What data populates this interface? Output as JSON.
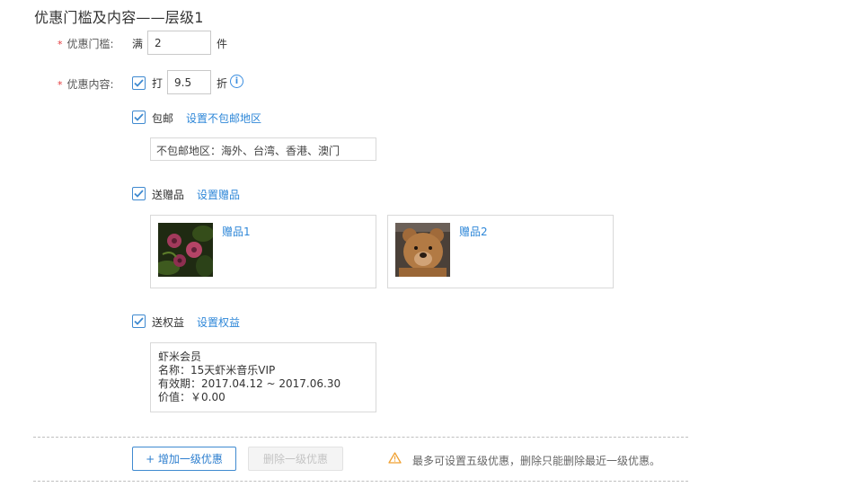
{
  "header": {
    "title": "优惠门槛及内容——层级1"
  },
  "threshold": {
    "label": "优惠门槛:",
    "prefix": "满",
    "value": "2",
    "suffix": "件"
  },
  "content": {
    "label": "优惠内容:",
    "discount": {
      "prefix": "打",
      "value": "9.5",
      "suffix": "折",
      "checked": true
    },
    "shipping": {
      "label": "包邮",
      "link": "设置不包邮地区",
      "checked": true,
      "excluded_regions": "不包邮地区：海外、台湾、香港、澳门"
    },
    "gifts": {
      "label": "送赠品",
      "link": "设置赠品",
      "checked": true,
      "items": [
        {
          "name": "赠品1",
          "image": "flower-photo"
        },
        {
          "name": "赠品2",
          "image": "teddy-bear-photo"
        }
      ]
    },
    "benefits": {
      "label": "送权益",
      "link": "设置权益",
      "checked": true,
      "card": {
        "title": "虾米会员",
        "name_line": "名称：15天虾米音乐VIP",
        "validity_line": "有效期：2017.04.12 ~ 2017.06.30",
        "value_line": "价值：￥0.00"
      }
    }
  },
  "footer": {
    "add_button": "+ 增加一级优惠",
    "delete_button": "删除一级优惠",
    "warning": "最多可设置五级优惠，删除只能删除最近一级优惠。"
  },
  "colors": {
    "accent": "#2e87d8",
    "required": "#e4393c",
    "warning": "#f0a030"
  },
  "icons": {
    "required": "asterisk",
    "checkbox": "checkmark",
    "info": "info-circle-icon",
    "warning": "warning-triangle-icon"
  }
}
